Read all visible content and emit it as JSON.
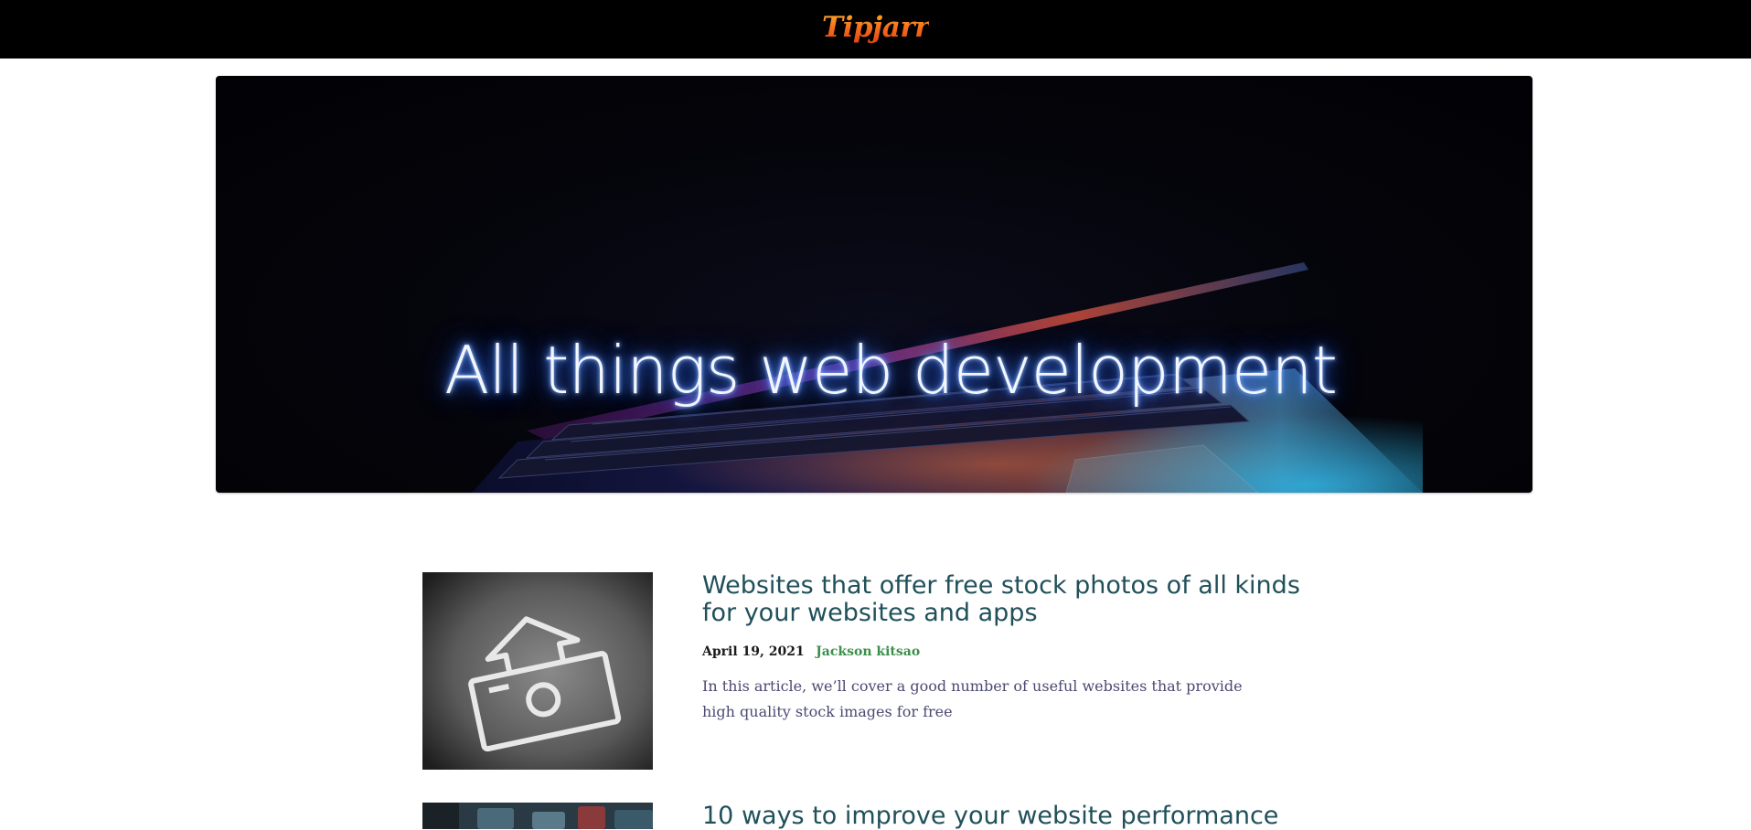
{
  "header": {
    "logo_text": "Tipjarr"
  },
  "hero": {
    "title": "All things web development"
  },
  "posts": [
    {
      "title": "Websites that offer free stock photos of all kinds for your websites and apps",
      "date": "April 19, 2021",
      "author": "Jackson kitsao",
      "excerpt": "In this article, we’ll cover a good number of useful websites that provide high quality stock images for free"
    },
    {
      "title": "10 ways to improve your website performance"
    }
  ],
  "colors": {
    "topbar": "#000000",
    "logo_gradient": [
      "#ffb12a",
      "#e2420e"
    ],
    "post_title": "#20505a",
    "author": "#3a8f4a",
    "excerpt": "#4b4a72"
  }
}
